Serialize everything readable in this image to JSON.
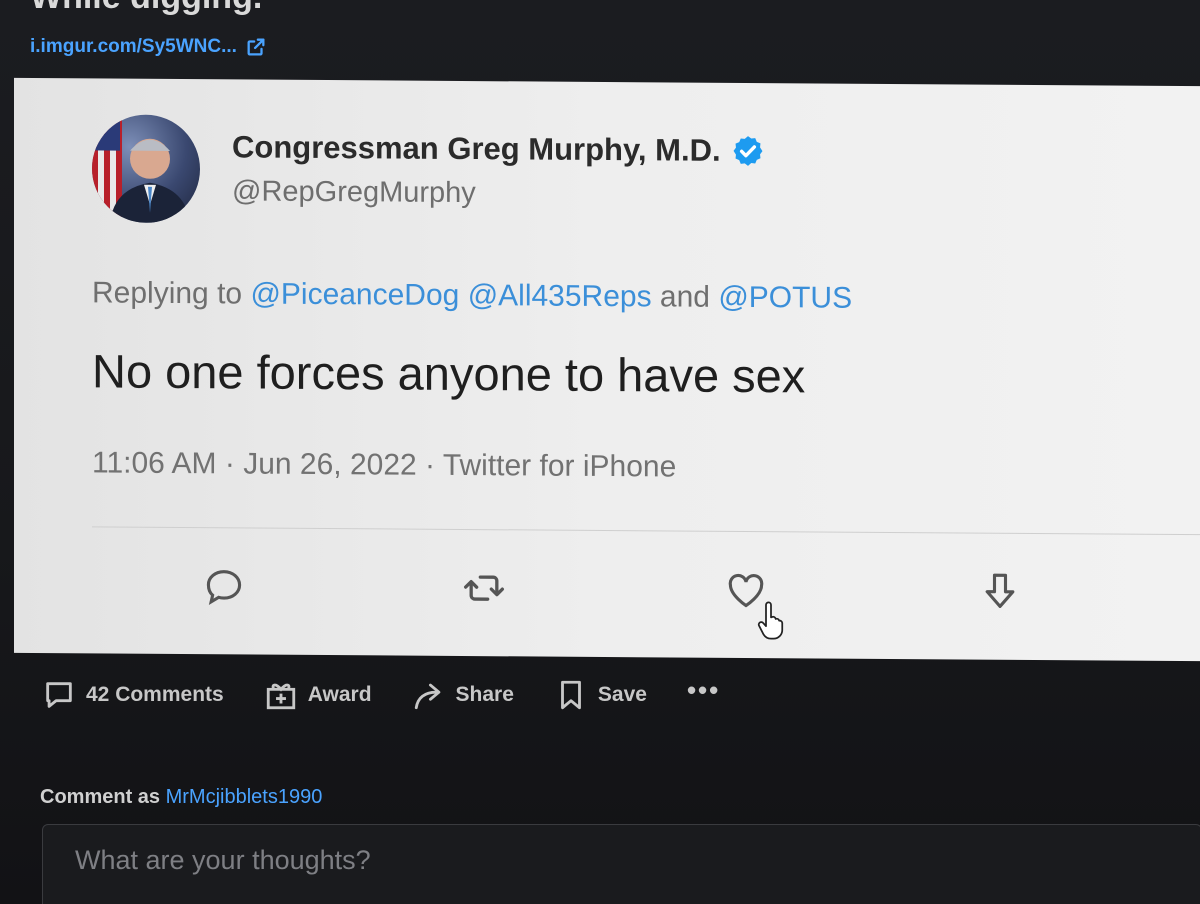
{
  "post": {
    "title": "While digging.",
    "link_text": "i.imgur.com/Sy5WNC..."
  },
  "tweet": {
    "display_name": "Congressman Greg Murphy, M.D.",
    "handle": "@RepGregMurphy",
    "replying_prefix": "Replying to ",
    "mention_1": "@PiceanceDog",
    "mention_2": "@All435Reps",
    "and_text": " and ",
    "mention_3": "@POTUS",
    "text": "No one forces anyone to have sex",
    "time": "11:06 AM",
    "date": "Jun 26, 2022",
    "source": "Twitter for iPhone",
    "separator": " · "
  },
  "actions": {
    "comments": "42 Comments",
    "award": "Award",
    "share": "Share",
    "save": "Save",
    "more": "•••"
  },
  "comment": {
    "prefix": "Comment as ",
    "username": "MrMcjibblets1990",
    "placeholder": "What are your thoughts?"
  },
  "colors": {
    "link": "#4aa3ff",
    "mention": "#3b8fd9",
    "verified": "#1d9bf0"
  }
}
